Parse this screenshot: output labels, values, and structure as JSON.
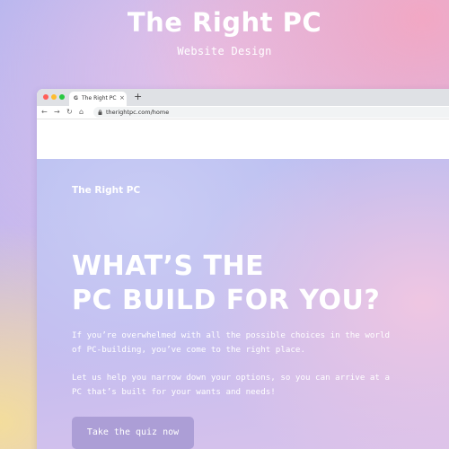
{
  "presentation": {
    "title": "The Right PC",
    "subtitle": "Website Design"
  },
  "browser": {
    "tab_title": "The Right PC",
    "tab_favicon": "G",
    "tab_close": "×",
    "new_tab": "+",
    "url": "therightpc.com/home",
    "nav_icons": [
      "back-arrow-icon",
      "forward-arrow-icon",
      "reload-icon",
      "home-icon",
      "lock-icon"
    ]
  },
  "site": {
    "logo": "The Right PC",
    "hero_line_1": "WHAT’S THE",
    "hero_line_2": "PC BUILD FOR YOU?",
    "paragraph_1": "If you’re overwhelmed with all the possible choices in the world of PC-building, you’ve come to the right place.",
    "paragraph_2": "Let us help you narrow down your options, so you can arrive at a PC that’s built for your wants and needs!",
    "cta_label": "Take the quiz now"
  },
  "colors": {
    "cta_background": "#ac9ed6",
    "text": "#ffffff"
  }
}
